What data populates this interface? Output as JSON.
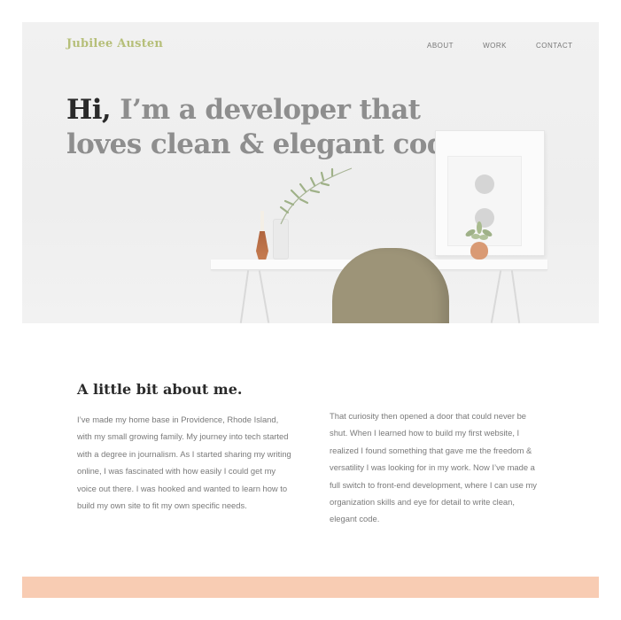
{
  "header": {
    "logo": "Jubilee Austen",
    "nav": [
      {
        "label": "ABOUT"
      },
      {
        "label": "WORK"
      },
      {
        "label": "CONTACT"
      }
    ]
  },
  "hero": {
    "greeting": "Hi,",
    "headline_rest": " I’m a developer that loves clean & elegant code."
  },
  "about": {
    "title": "A little bit about me.",
    "paragraph_left": "I’ve made my home base in Providence, Rhode Island, with my small growing family. My journey into tech started with a degree in journalism. As I started sharing my writing online, I was fascinated with how easily I could get my voice out there. I was hooked and wanted to learn how to build my own site to fit my own specific needs.",
    "paragraph_right": "That curiosity then opened a door that could never be shut. When I learned how to build my first website, I realized I found something that gave me the freedom & versatility I was looking for in my work. Now I’ve made a full switch to front-end development, where I can use my organization skills and eye for detail to write clean, elegant code."
  },
  "colors": {
    "accent": "#b6bf79",
    "footer_band": "#f8ccb3",
    "headline": "#8e8e8e"
  }
}
